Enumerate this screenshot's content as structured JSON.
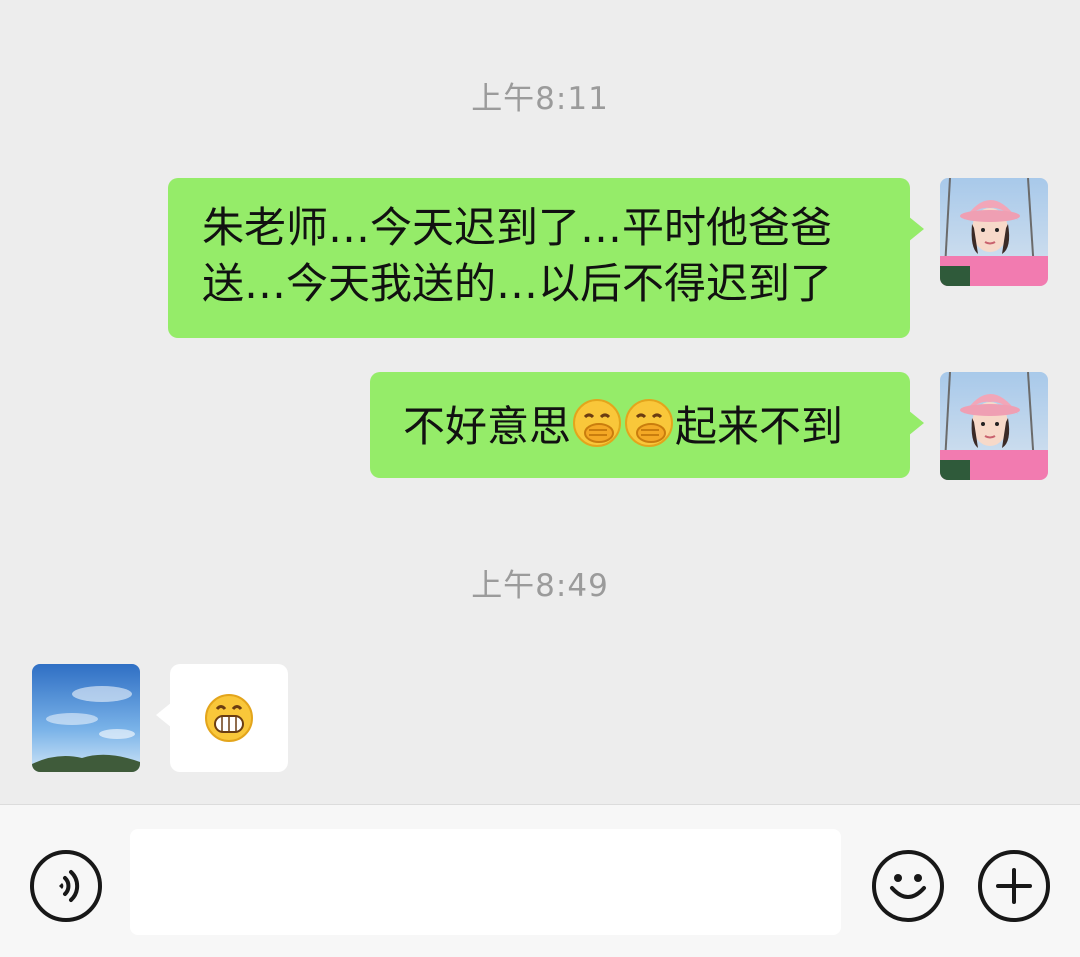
{
  "messages": [
    {
      "type": "timestamp",
      "text": "上午8:11"
    },
    {
      "type": "bubble",
      "sender": "me",
      "line1": "朱老师…今天迟到了…平时他爸爸",
      "line2": "送…今天我送的…以后不得迟到了"
    },
    {
      "type": "bubble",
      "sender": "me",
      "text_before": "不好意思",
      "emoji": "covering-mouth-laugh-emoji",
      "emoji_count": 2,
      "text_after": "起来不到"
    },
    {
      "type": "timestamp",
      "text": "上午8:49"
    },
    {
      "type": "bubble",
      "sender": "other",
      "emoji": "grinning-teeth-emoji"
    }
  ],
  "input_bar": {
    "voice_icon": "voice-wave-icon",
    "input_value": "",
    "emoji_icon": "smiley-face-icon",
    "more_icon": "plus-icon"
  },
  "colors": {
    "background": "#ededed",
    "my_bubble": "#95ec69",
    "other_bubble": "#ffffff",
    "timestamp": "#9b9b9b"
  }
}
